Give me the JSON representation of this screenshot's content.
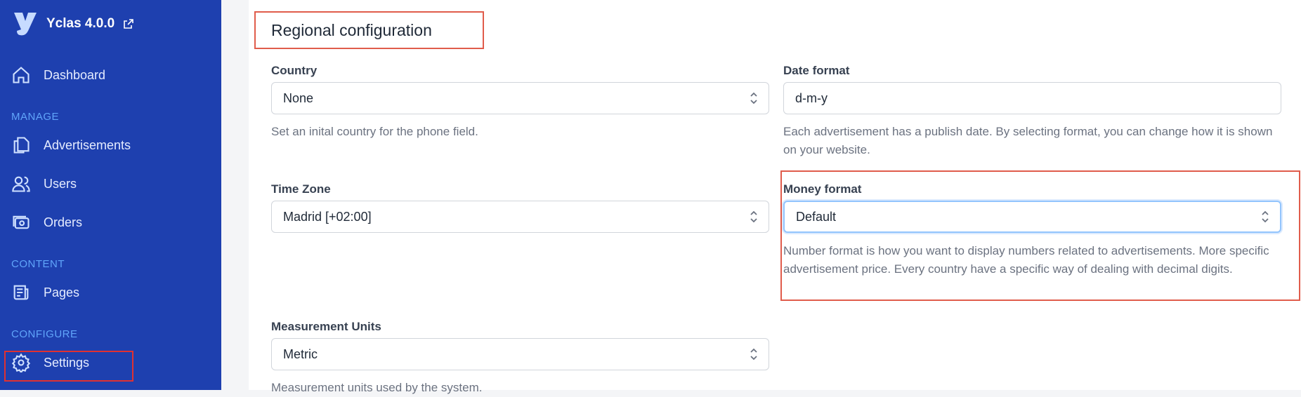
{
  "sidebar": {
    "brand": "Yclas 4.0.0",
    "items": {
      "dashboard": "Dashboard",
      "advertisements": "Advertisements",
      "users": "Users",
      "orders": "Orders",
      "pages": "Pages",
      "settings": "Settings"
    },
    "sections": {
      "manage": "MANAGE",
      "content": "CONTENT",
      "configure": "CONFIGURE"
    }
  },
  "main": {
    "title": "Regional configuration",
    "country": {
      "label": "Country",
      "value": "None",
      "help": "Set an inital country for the phone field."
    },
    "date_format": {
      "label": "Date format",
      "value": "d-m-y",
      "help": "Each advertisement has a publish date. By selecting format, you can change how it is shown on your website."
    },
    "time_zone": {
      "label": "Time Zone",
      "value": "Madrid [+02:00]"
    },
    "money_format": {
      "label": "Money format",
      "value": "Default",
      "help": "Number format is how you want to display numbers related to advertisements. More specific advertisement price. Every country have a specific way of dealing with decimal digits."
    },
    "measurement_units": {
      "label": "Measurement Units",
      "value": "Metric",
      "help": "Measurement units used by the system."
    }
  },
  "colors": {
    "sidebar_bg": "#1e40af",
    "section_label": "#60a5fa",
    "highlight": "#e05c4b"
  }
}
